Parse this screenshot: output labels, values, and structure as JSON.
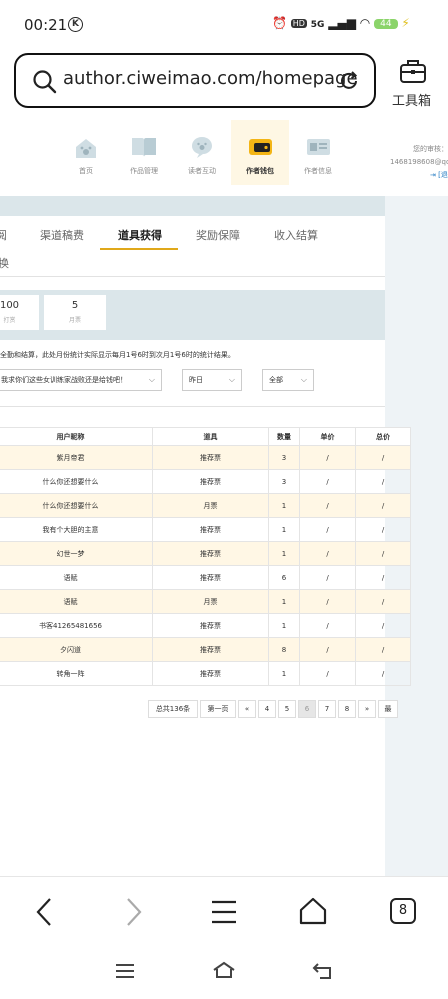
{
  "status_bar": {
    "time": "00:21",
    "badge_k": "K",
    "hd": "HD",
    "network": "5G",
    "battery": "44"
  },
  "browser": {
    "url": "author.ciweimao.com/homepage",
    "toolbox_label": "工具箱",
    "tab_count": "8"
  },
  "nav": {
    "items": [
      {
        "label": "首页",
        "icon": "paw-house-icon"
      },
      {
        "label": "作品管理",
        "icon": "book-icon"
      },
      {
        "label": "读者互动",
        "icon": "chat-paw-icon"
      },
      {
        "label": "作者钱包",
        "icon": "wallet-icon"
      },
      {
        "label": "作者信息",
        "icon": "id-card-icon"
      }
    ],
    "user_line1": "您的审核：",
    "user_line2": "1468198608@qq",
    "logout_text": "[退"
  },
  "tabs": [
    {
      "label": "阅"
    },
    {
      "label": "渠道稿费"
    },
    {
      "label": "道具获得"
    },
    {
      "label": "奖励保障"
    },
    {
      "label": "收入结算"
    }
  ],
  "tab_row2": "换",
  "stats": [
    {
      "value": "100",
      "label": "打赏"
    },
    {
      "value": "5",
      "label": "月票"
    }
  ],
  "note": "全勤和结算，此处月份统计实际显示每月1号6时到次月1号6时的统计结果。",
  "filters": {
    "book": "我求你们这些女训练家战败还是给钱吧！",
    "date": "昨日",
    "type": "全部"
  },
  "table": {
    "headers": [
      "用户昵称",
      "道具",
      "数量",
      "单价",
      "总价"
    ],
    "rows": [
      [
        "紫月帝君",
        "推荐票",
        "3",
        "/",
        "/"
      ],
      [
        "什么你还想要什么",
        "推荐票",
        "3",
        "/",
        "/"
      ],
      [
        "什么你还想要什么",
        "月票",
        "1",
        "/",
        "/"
      ],
      [
        "我有个大胆的主意",
        "推荐票",
        "1",
        "/",
        "/"
      ],
      [
        "幻世一梦",
        "推荐票",
        "1",
        "/",
        "/"
      ],
      [
        "语赋",
        "推荐票",
        "6",
        "/",
        "/"
      ],
      [
        "语赋",
        "月票",
        "1",
        "/",
        "/"
      ],
      [
        "书客41265481656",
        "推荐票",
        "1",
        "/",
        "/"
      ],
      [
        "夕闪道",
        "推荐票",
        "8",
        "/",
        "/"
      ],
      [
        "转角一阵",
        "推荐票",
        "1",
        "/",
        "/"
      ]
    ]
  },
  "pager": {
    "total": "总共136条",
    "first": "第一页",
    "prev": "«",
    "pages": [
      "4",
      "5",
      "6",
      "7",
      "8"
    ],
    "current": "6",
    "next": "»",
    "last": "最"
  },
  "colors": {
    "accent": "#e0a81a",
    "row_highlight": "#fff7e5",
    "band": "#dbe6ea"
  }
}
